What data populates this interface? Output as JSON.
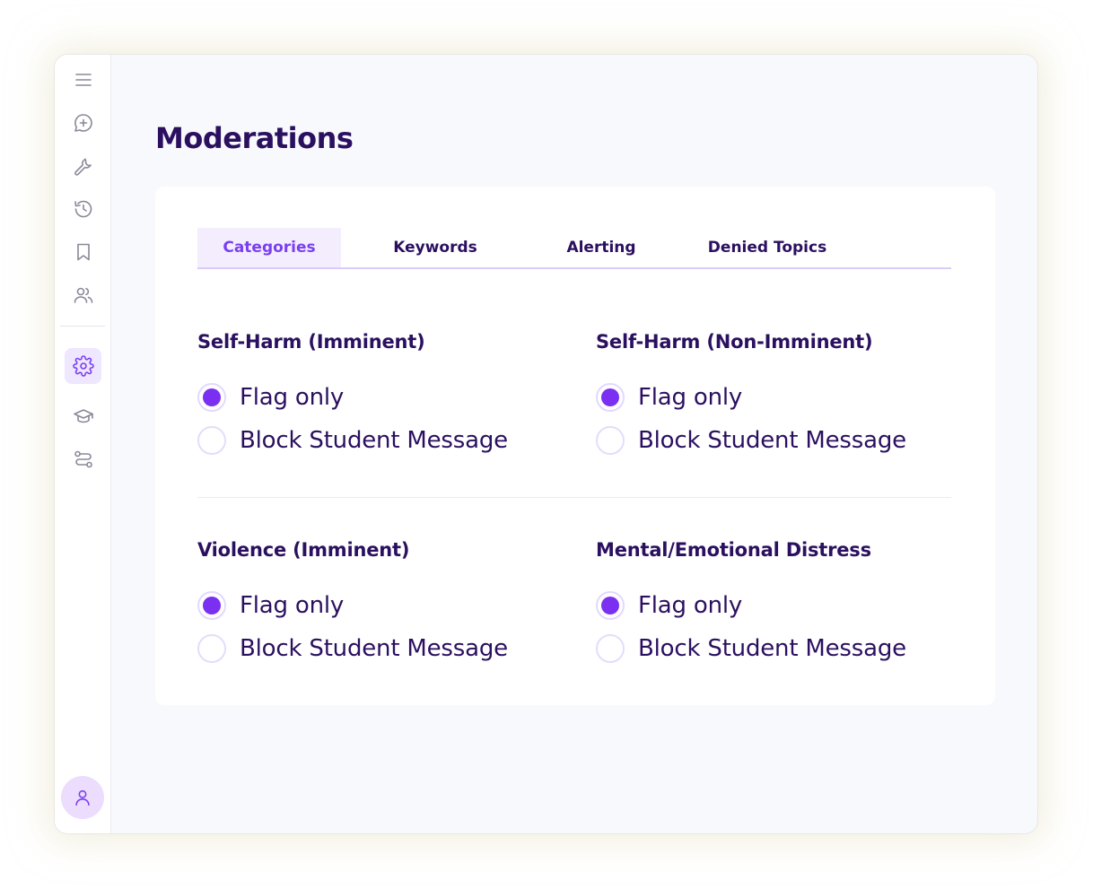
{
  "page": {
    "title": "Moderations"
  },
  "sidebar": {
    "items": [
      {
        "icon": "menu-icon"
      },
      {
        "icon": "new-chat-icon"
      },
      {
        "icon": "wrench-icon"
      },
      {
        "icon": "history-icon"
      },
      {
        "icon": "bookmark-icon"
      },
      {
        "icon": "users-icon"
      },
      {
        "icon": "gear-icon",
        "active": true
      },
      {
        "icon": "graduation-cap-icon"
      },
      {
        "icon": "workflow-icon"
      }
    ],
    "avatar_icon": "user-icon"
  },
  "tabs": [
    {
      "label": "Categories",
      "active": true
    },
    {
      "label": "Keywords",
      "active": false
    },
    {
      "label": "Alerting",
      "active": false
    },
    {
      "label": "Denied Topics",
      "active": false
    }
  ],
  "categories": [
    {
      "title": "Self-Harm (Imminent)",
      "options": [
        {
          "label": "Flag only",
          "selected": true
        },
        {
          "label": "Block Student Message",
          "selected": false
        }
      ]
    },
    {
      "title": "Self-Harm (Non-Imminent)",
      "options": [
        {
          "label": "Flag only",
          "selected": true
        },
        {
          "label": "Block Student Message",
          "selected": false
        }
      ]
    },
    {
      "title": "Violence (Imminent)",
      "options": [
        {
          "label": "Flag only",
          "selected": true
        },
        {
          "label": "Block Student Message",
          "selected": false
        }
      ]
    },
    {
      "title": "Mental/Emotional Distress",
      "options": [
        {
          "label": "Flag only",
          "selected": true
        },
        {
          "label": "Block Student Message",
          "selected": false
        }
      ]
    }
  ],
  "colors": {
    "accent": "#7b2ff0",
    "text": "#2b1060",
    "icon": "#8a8898",
    "active_icon": "#7a3ff0"
  }
}
